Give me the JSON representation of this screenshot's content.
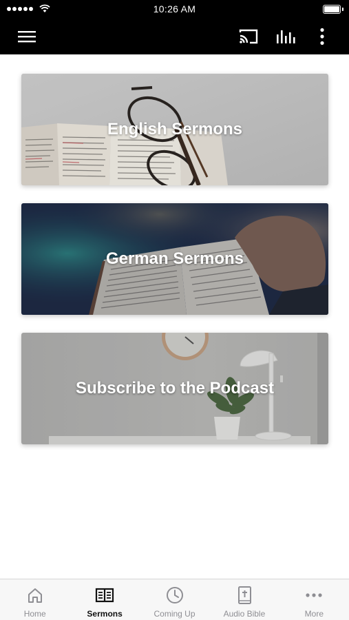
{
  "status_bar": {
    "time": "10:26 AM"
  },
  "app_bar": {
    "icons": [
      "menu-icon",
      "cast-icon",
      "equalizer-icon",
      "more-vertical-icon"
    ]
  },
  "cards": [
    {
      "label": "English Sermons",
      "image": "open-bible-with-glasses"
    },
    {
      "label": "German Sermons",
      "image": "hand-holding-bible"
    },
    {
      "label": "Subscribe to the Podcast",
      "image": "desk-with-plant-lamp-clock"
    }
  ],
  "tab_bar": {
    "active": "Sermons",
    "tabs": [
      {
        "label": "Home",
        "icon": "home-icon"
      },
      {
        "label": "Sermons",
        "icon": "book-icon"
      },
      {
        "label": "Coming Up",
        "icon": "clock-icon"
      },
      {
        "label": "Audio Bible",
        "icon": "bible-icon"
      },
      {
        "label": "More",
        "icon": "more-horizontal-icon"
      }
    ]
  },
  "colors": {
    "app_bar": "#000000",
    "tab_active": "#111111",
    "tab_inactive": "#8e8e93"
  }
}
